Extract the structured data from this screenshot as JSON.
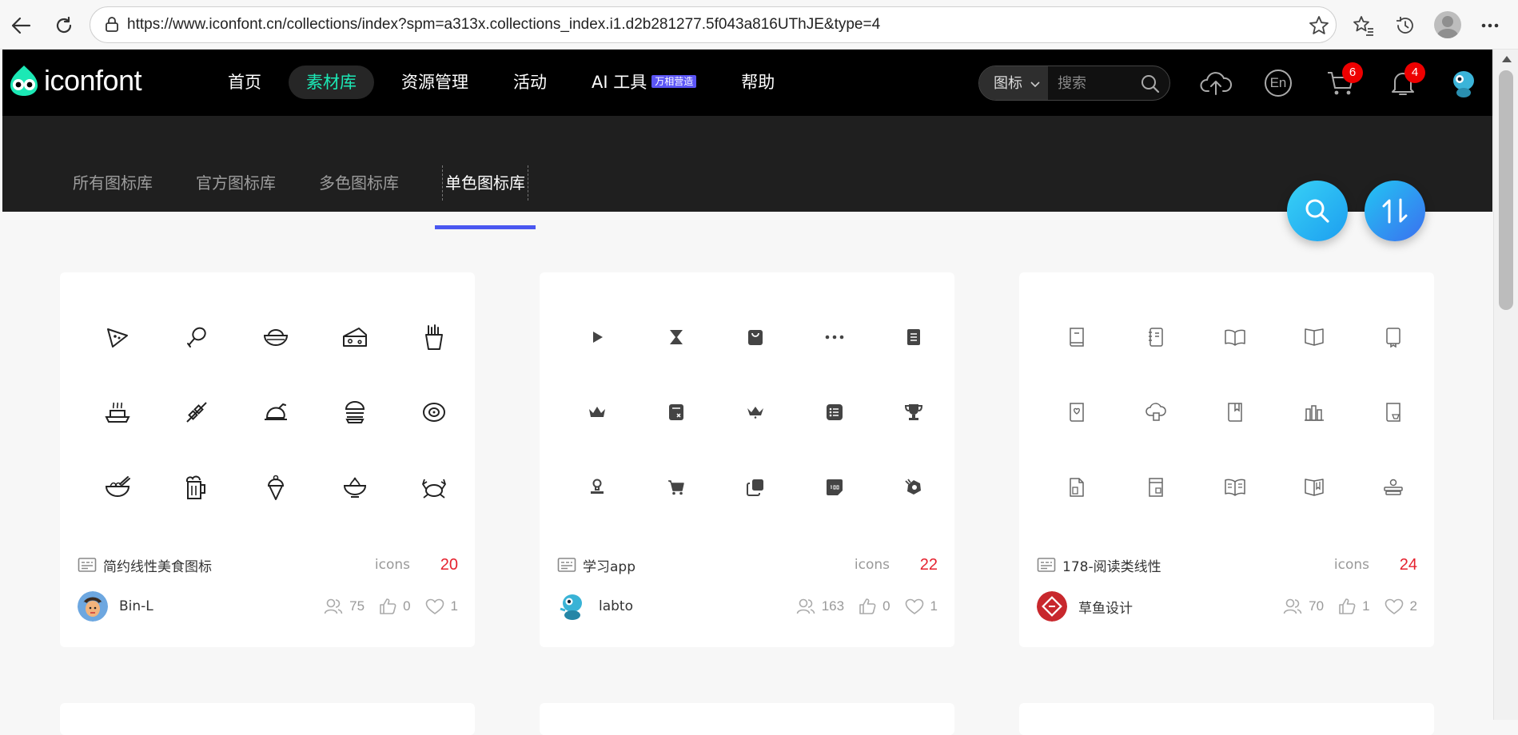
{
  "browser": {
    "url": "https://www.iconfont.cn/collections/index?spm=a313x.collections_index.i1.d2b281277.5f043a816UThJE&type=4"
  },
  "header": {
    "logo_text": "iconfont",
    "nav": [
      {
        "label": "首页"
      },
      {
        "label": "素材库",
        "active": true
      },
      {
        "label": "资源管理"
      },
      {
        "label": "活动"
      },
      {
        "label": "AI 工具",
        "badge": "万相营造"
      },
      {
        "label": "帮助"
      }
    ],
    "search": {
      "type_label": "图标",
      "placeholder": "搜索"
    },
    "lang_label": "En",
    "cart_count": "6",
    "notification_count": "4"
  },
  "sub_tabs": [
    {
      "label": "所有图标库"
    },
    {
      "label": "官方图标库"
    },
    {
      "label": "多色图标库"
    },
    {
      "label": "单色图标库",
      "active": true
    }
  ],
  "cards": [
    {
      "title": "简约线性美食图标",
      "icons_label": "icons",
      "icons_count": "20",
      "user": "Bin-L",
      "stats": {
        "contributors": "75",
        "likes": "0",
        "favorites": "1"
      },
      "icons": [
        "pizza-slice-icon",
        "drumstick-icon",
        "rice-bowl-icon",
        "cheese-icon",
        "fries-icon",
        "hot-dish-icon",
        "kebab-icon",
        "roast-chicken-icon",
        "burger-icon",
        "steak-icon",
        "noodle-bowl-icon",
        "beer-mug-icon",
        "ice-cream-icon",
        "soup-pot-icon",
        "crab-icon"
      ]
    },
    {
      "title": "学习app",
      "icons_label": "icons",
      "icons_count": "22",
      "user": "labto",
      "stats": {
        "contributors": "163",
        "likes": "0",
        "favorites": "1"
      },
      "icons": [
        "play-icon",
        "hourglass-icon",
        "bag-icon",
        "more-dots-icon",
        "document-icon",
        "crown-icon",
        "calculator-icon",
        "small-crown-icon",
        "list-icon",
        "trophy-icon",
        "stamp-icon",
        "cart-icon",
        "copy-icon",
        "score-icon",
        "badge-icon"
      ]
    },
    {
      "title": "178-阅读类线性",
      "icons_label": "icons",
      "icons_count": "24",
      "user": "草鱼设计",
      "stats": {
        "contributors": "70",
        "likes": "1",
        "favorites": "2"
      },
      "icons": [
        "book-icon",
        "notebook-icon",
        "open-book-icon",
        "open-book-alt-icon",
        "tablet-book-icon",
        "favorite-book-icon",
        "cloud-book-icon",
        "bookmark-book-icon",
        "bookshelf-icon",
        "reader-icon",
        "file-book-icon",
        "ebook-icon",
        "reading-icon",
        "map-book-icon",
        "book-stack-icon"
      ]
    }
  ],
  "colors": {
    "accent_green": "#1ce8b5",
    "tab_underline": "#4a57f0",
    "count_red": "#e5222e",
    "badge_red": "#ee0000"
  }
}
